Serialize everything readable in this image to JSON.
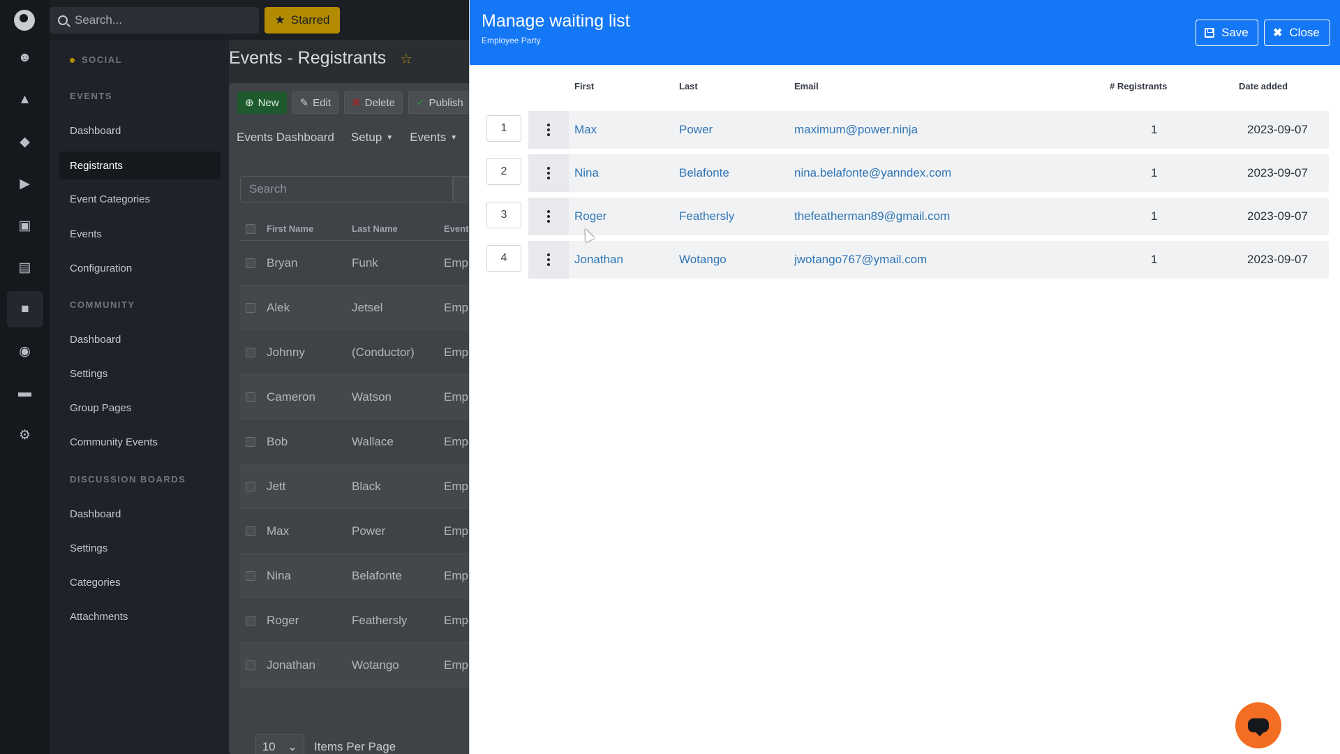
{
  "search": {
    "placeholder": "Search..."
  },
  "starred_label": "Starred",
  "rail": {
    "icons": [
      "logo-icon",
      "users-icon",
      "shapes-icon",
      "graduation-cap-icon",
      "megaphone-icon",
      "ticket-icon",
      "chart-icon",
      "chat-icon",
      "palette-icon",
      "card-icon",
      "gear-icon"
    ]
  },
  "nav": {
    "social": "SOCIAL",
    "events": "EVENTS",
    "events_items": [
      "Dashboard",
      "Registrants",
      "Event Categories",
      "Events",
      "Configuration"
    ],
    "community": "COMMUNITY",
    "community_items": [
      "Dashboard",
      "Settings",
      "Group Pages",
      "Community Events"
    ],
    "discussion": "DISCUSSION BOARDS",
    "discussion_items": [
      "Dashboard",
      "Settings",
      "Categories",
      "Attachments"
    ]
  },
  "main": {
    "title": "Events - Registrants",
    "buttons": {
      "new": "New",
      "edit": "Edit",
      "delete": "Delete",
      "publish": "Publish"
    },
    "submenu": [
      "Events Dashboard",
      "Setup",
      "Events"
    ],
    "search_placeholder": "Search",
    "columns": [
      "First Name",
      "Last Name",
      "Event"
    ],
    "rows": [
      {
        "first": "Bryan",
        "last": "Funk",
        "event": "Empl"
      },
      {
        "first": "Alek",
        "last": "Jetsel",
        "event": "Empl"
      },
      {
        "first": "Johnny",
        "last": "(Conductor)",
        "event": "Empl"
      },
      {
        "first": "Cameron",
        "last": "Watson",
        "event": "Empl"
      },
      {
        "first": "Bob",
        "last": "Wallace",
        "event": "Empl"
      },
      {
        "first": "Jett",
        "last": "Black",
        "event": "Empl"
      },
      {
        "first": "Max",
        "last": "Power",
        "event": "Empl"
      },
      {
        "first": "Nina",
        "last": "Belafonte",
        "event": "Empl"
      },
      {
        "first": "Roger",
        "last": "Feathersly",
        "event": "Empl"
      },
      {
        "first": "Jonathan",
        "last": "Wotango",
        "event": "Empl"
      }
    ],
    "per_page": "10",
    "per_page_label": "Items Per Page"
  },
  "modal": {
    "title": "Manage waiting list",
    "subtitle": "Employee Party",
    "save": "Save",
    "close": "Close",
    "columns": {
      "first": "First",
      "last": "Last",
      "email": "Email",
      "registrants": "# Registrants",
      "date": "Date added"
    },
    "rows": [
      {
        "pos": "1",
        "first": "Max",
        "last": "Power",
        "email": "maximum@power.ninja",
        "registrants": "1",
        "date": "2023-09-07"
      },
      {
        "pos": "2",
        "first": "Nina",
        "last": "Belafonte",
        "email": "nina.belafonte@yanndex.com",
        "registrants": "1",
        "date": "2023-09-07"
      },
      {
        "pos": "3",
        "first": "Roger",
        "last": "Feathersly",
        "email": "thefeatherman89@gmail.com",
        "registrants": "1",
        "date": "2023-09-07"
      },
      {
        "pos": "4",
        "first": "Jonathan",
        "last": "Wotango",
        "email": "jwotango767@ymail.com",
        "registrants": "1",
        "date": "2023-09-07"
      }
    ]
  },
  "colors": {
    "accent": "#1477f5",
    "starred": "#b28b00",
    "link": "#2f76b5",
    "chat": "#f36e22"
  }
}
